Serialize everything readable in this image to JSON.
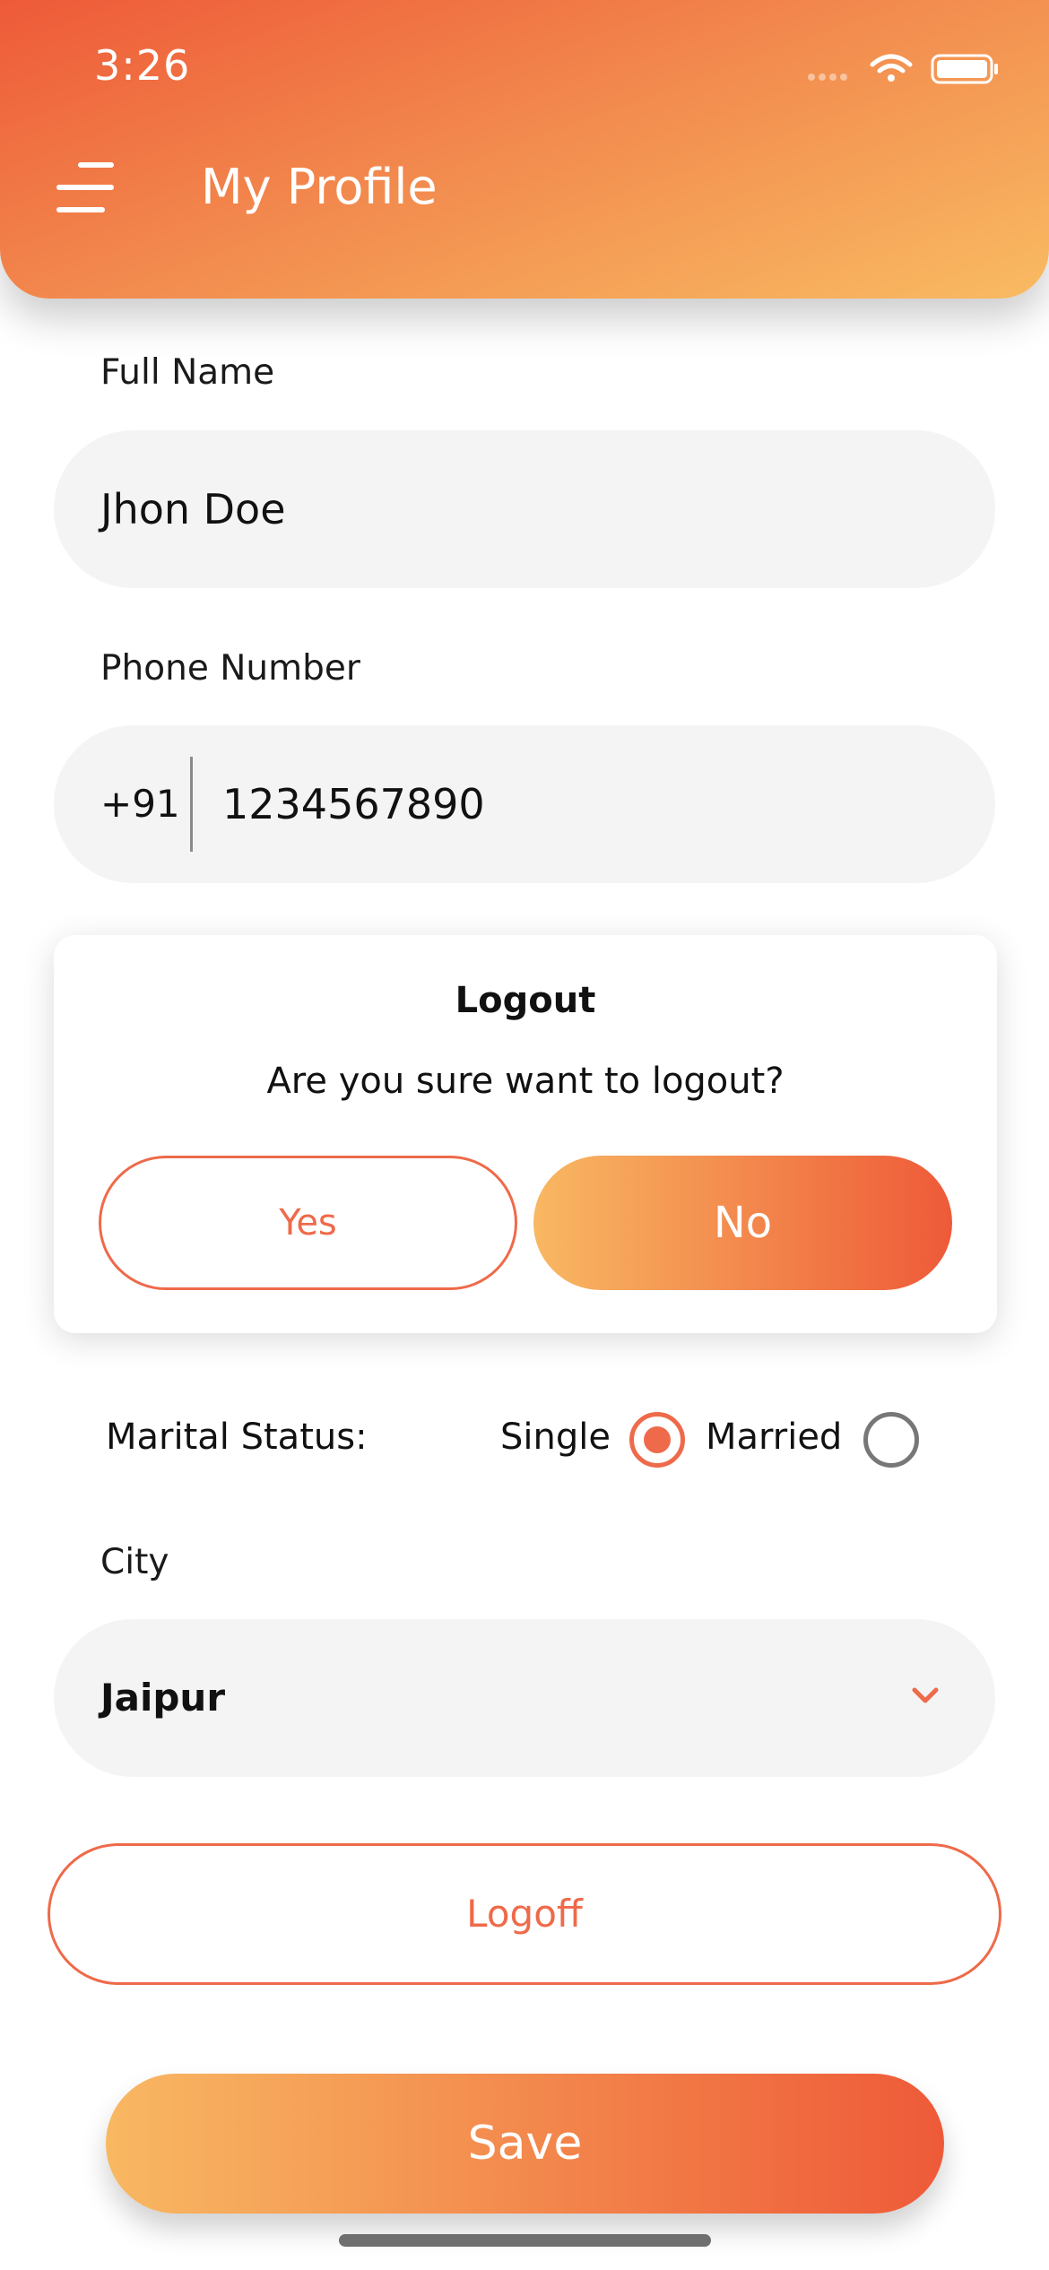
{
  "status_bar": {
    "time": "3:26",
    "icons": [
      "signal-icon",
      "wifi-icon",
      "battery-icon"
    ]
  },
  "header": {
    "menu_icon": "menu-icon",
    "title": "My Profile"
  },
  "form": {
    "full_name": {
      "label": "Full Name",
      "value": "Jhon Doe"
    },
    "phone": {
      "label": "Phone Number",
      "country_code": "+91",
      "value": "1234567890"
    },
    "marital_status": {
      "label": "Marital Status:",
      "options": [
        {
          "label": "Single",
          "selected": true
        },
        {
          "label": "Married",
          "selected": false
        }
      ]
    },
    "city": {
      "label": "City",
      "value": "Jaipur",
      "icon": "chevron-down-icon"
    }
  },
  "dialog": {
    "title": "Logout",
    "message": "Are you sure want to logout?",
    "yes_label": "Yes",
    "no_label": "No"
  },
  "buttons": {
    "logoff_label": "Logoff",
    "save_label": "Save"
  },
  "colors": {
    "accent": "#ee6a4a",
    "gradient_start": "#f8b862",
    "gradient_end": "#ee5a38",
    "field_bg": "#f4f4f4"
  }
}
